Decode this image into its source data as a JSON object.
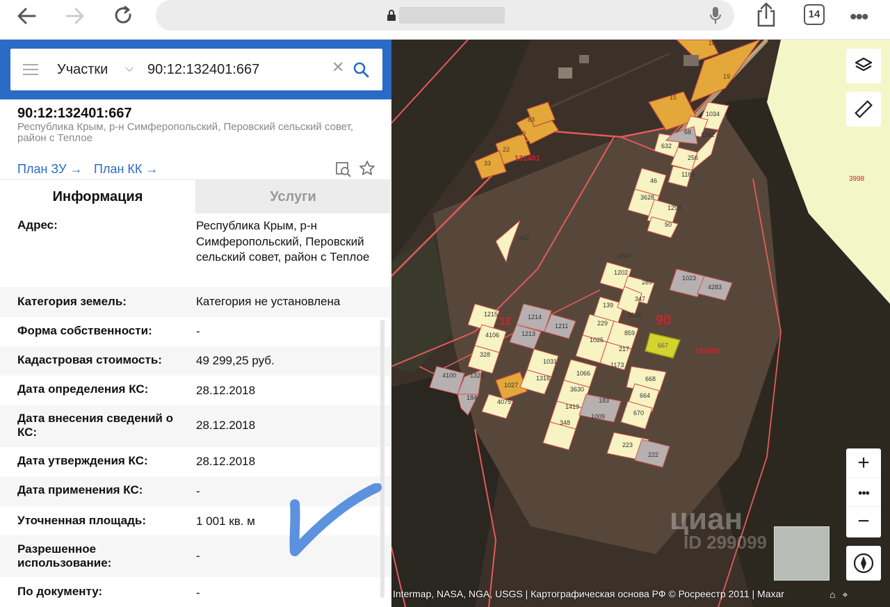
{
  "browser": {
    "tab_count": "14"
  },
  "search": {
    "scope": "Участки",
    "query": "90:12:132401:667"
  },
  "parcel": {
    "number": "90:12:132401:667",
    "address": "Республика Крым, р-н Симферопольский, Перовский сельский совет, район с Теплое",
    "links": [
      "План ЗУ",
      "План КК"
    ]
  },
  "tabs": {
    "info": "Информация",
    "services": "Услуги"
  },
  "info": [
    {
      "key": "Адрес:",
      "value": "Республика Крым, р-н Симферопольский, Перовский сельский совет, район с Теплое"
    },
    {
      "key": "Категория земель:",
      "value": "Категория не установлена"
    },
    {
      "key": "Форма собственности:",
      "value": "-"
    },
    {
      "key": "Кадастровая стоимость:",
      "value": "49 299,25 руб."
    },
    {
      "key": "Дата определения КС:",
      "value": "28.12.2018"
    },
    {
      "key": "Дата внесения сведений о КС:",
      "value": "28.12.2018"
    },
    {
      "key": "Дата утверждения КС:",
      "value": "28.12.2018"
    },
    {
      "key": "Дата применения КС:",
      "value": "-"
    },
    {
      "key": "Уточненная площадь:",
      "value": "1 001 кв. м"
    },
    {
      "key": "Разрешенное использование:",
      "value": "-"
    },
    {
      "key": "По документу:",
      "value": "-"
    }
  ],
  "map": {
    "block_labels": [
      "90",
      "12",
      "131401",
      "132401",
      "3998"
    ],
    "parcel_numbers": [
      "18",
      "19",
      "15",
      "1034",
      "68",
      "1262",
      "632",
      "256",
      "1189",
      "83",
      "80",
      "22",
      "33",
      "46",
      "3628",
      "1298",
      "50",
      "442",
      "4247",
      "1202",
      "289",
      "1023",
      "4283",
      "347",
      "139",
      "1026",
      "1215",
      "1214",
      "1211",
      "229",
      "859",
      "4106",
      "1213",
      "1025",
      "217",
      "667",
      "328",
      "1031",
      "1173",
      "4100",
      "1326",
      "1318",
      "1066",
      "668",
      "1027",
      "3630",
      "664",
      "184",
      "4075",
      "183",
      "1419",
      "1009",
      "670",
      "348",
      "223",
      "222"
    ],
    "watermark": "циан",
    "watermark_id": "ID 299099",
    "attribution": "Intermap, NASA, NGA, USGS | Картографическая основа РФ © Росреестр 2011 | Maxar"
  },
  "colors": {
    "accent": "#2a6bc5",
    "parcel_fill": "#f7f3c2",
    "parcel_gray": "#b7b0b0",
    "parcel_orange": "#e4a83a",
    "selected": "#d4d431",
    "boundary": "#e25b5b"
  }
}
